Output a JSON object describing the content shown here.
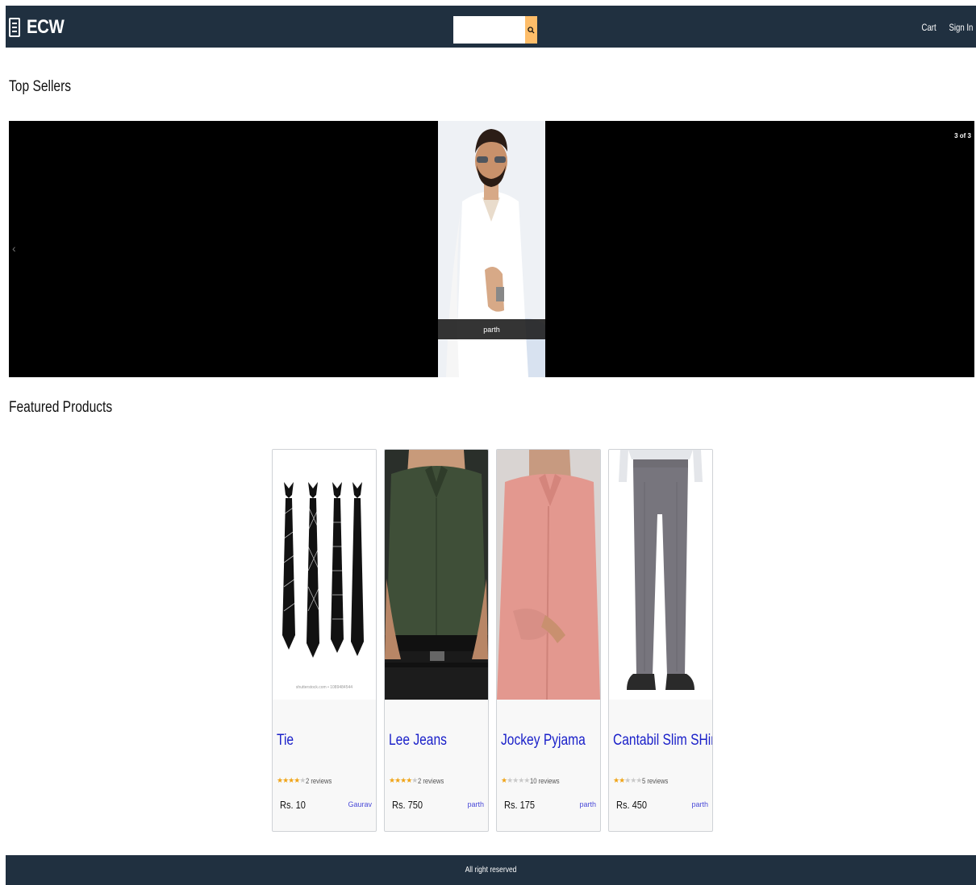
{
  "header": {
    "logo": "ECW",
    "search_placeholder": "",
    "search_value": "",
    "cart_label": "Cart",
    "signin_label": "Sign In"
  },
  "top_sellers": {
    "title": "Top Sellers",
    "counter": "3 of 3",
    "slide_caption": "parth"
  },
  "featured": {
    "title": "Featured Products",
    "products": [
      {
        "name": "Tie",
        "rating": 4,
        "reviews": "2 reviews",
        "price": "Rs. 10",
        "seller": "Gaurav",
        "watermark": "shutterstock.com • 1089484544"
      },
      {
        "name": "Lee Jeans",
        "rating": 4.5,
        "reviews": "2 reviews",
        "price": "Rs. 750",
        "seller": "parth"
      },
      {
        "name": "Jockey Pyjama",
        "rating": 1,
        "reviews": "10 reviews",
        "price": "Rs. 175",
        "seller": "parth"
      },
      {
        "name": "Cantabil Slim SHirt",
        "rating": 2,
        "reviews": "5 reviews",
        "price": "Rs. 450",
        "seller": "parth"
      }
    ]
  },
  "footer": {
    "text": "All right reserved"
  },
  "colors": {
    "header_bg": "#203040",
    "search_button": "#febd69",
    "title_link": "#1a20c9",
    "star": "#f0a418"
  }
}
